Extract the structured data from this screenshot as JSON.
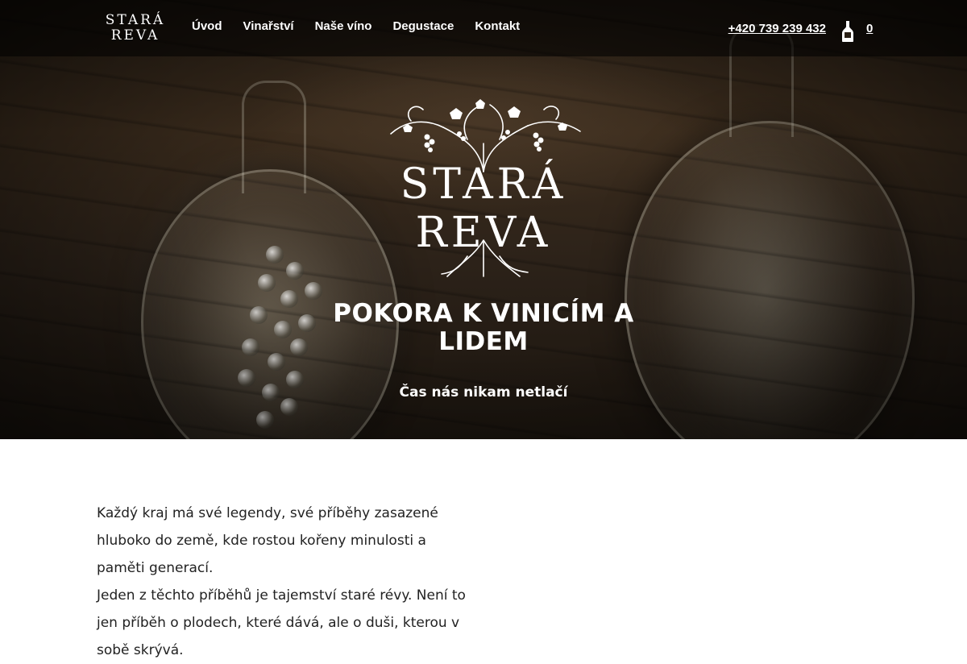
{
  "colors": {
    "nav_bg": "#000000",
    "text_light": "#ffffff",
    "body_text": "#222222"
  },
  "brand": {
    "line1": "STARÁ",
    "line2": "REVA"
  },
  "nav": {
    "items": [
      {
        "label": "Úvod"
      },
      {
        "label": "Vinařství"
      },
      {
        "label": "Naše víno"
      },
      {
        "label": "Degustace"
      },
      {
        "label": "Kontakt"
      }
    ],
    "phone": "+420 739 239 432",
    "cart_icon": "wine-bottle-icon",
    "cart_count": "0"
  },
  "hero": {
    "logo_line1": "STARÁ",
    "logo_line2": "REVA",
    "logo_icon": "grapevine-icon",
    "title": "POKORA K VINICÍM A LIDEM",
    "subtitle": "Čas nás nikam netlačí"
  },
  "intro": {
    "paragraphs": [
      "Každý kraj má své legendy, své příběhy zasazené hluboko do země, kde rostou kořeny minulosti a paměti generací.",
      "Jeden z těchto příběhů je tajemství staré révy. Není to jen příběh o plodech, které dává, ale o duši, kterou v sobě skrývá."
    ]
  }
}
